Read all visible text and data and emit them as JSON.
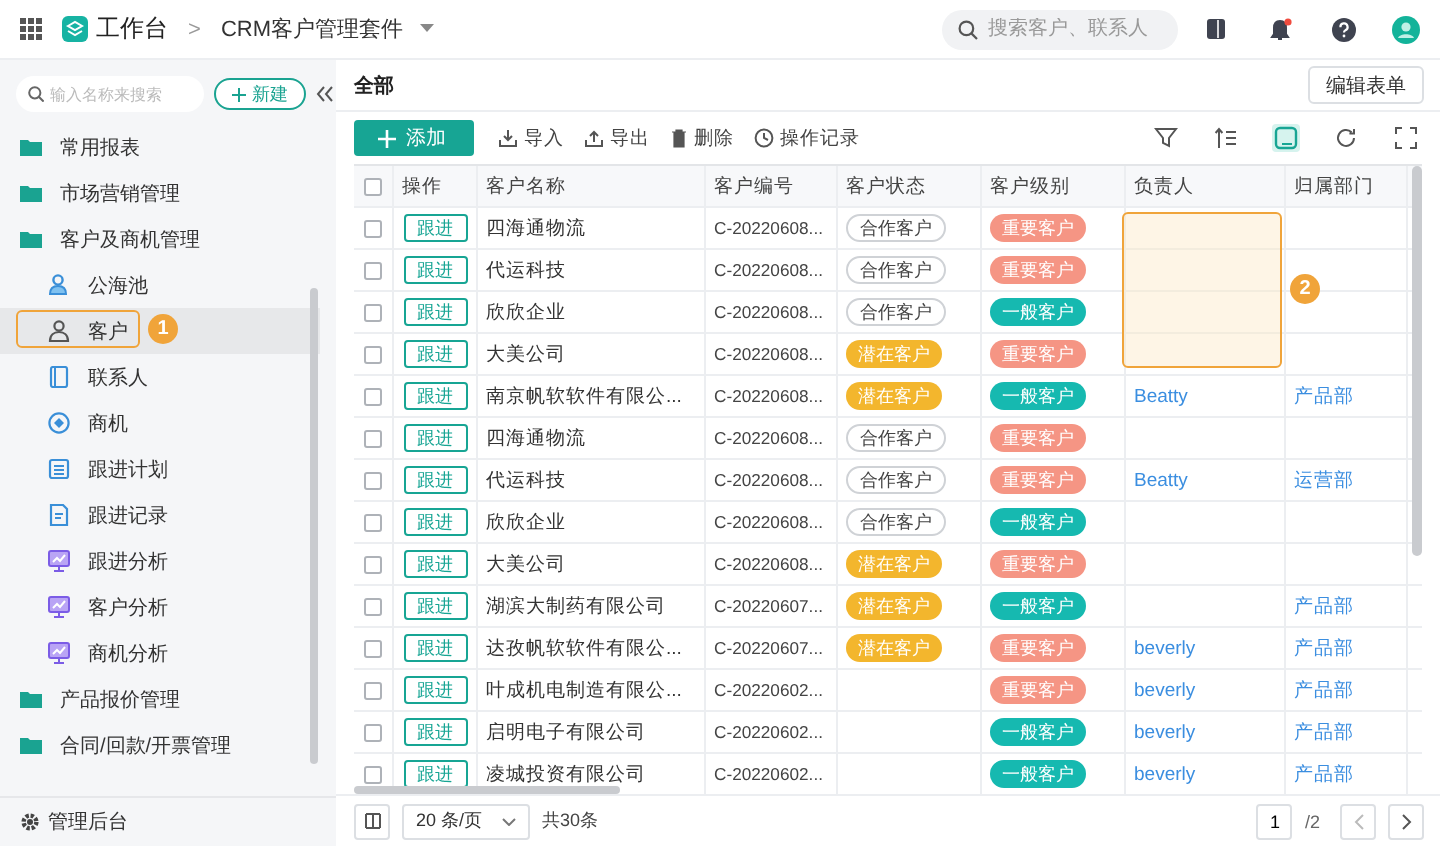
{
  "topbar": {
    "home": "工作台",
    "separator": ">",
    "app": "CRM客户管理套件",
    "search": {
      "placeholder": "搜索客户、联系人"
    },
    "notification_dot": true
  },
  "sidebar": {
    "search": {
      "placeholder": "输入名称来搜索"
    },
    "new_button": "新建",
    "items": [
      {
        "label": "常用报表",
        "selected": false
      },
      {
        "label": "市场营销管理",
        "selected": false
      },
      {
        "label": "客户及商机管理",
        "selected": false,
        "children": [
          {
            "label": "公海池",
            "kind": "pool",
            "selected": false
          },
          {
            "label": "客户",
            "kind": "customer",
            "selected": true,
            "callout": "1"
          },
          {
            "label": "联系人",
            "kind": "contact",
            "selected": false
          },
          {
            "label": "商机",
            "kind": "deal",
            "selected": false
          },
          {
            "label": "跟进计划",
            "kind": "plan",
            "selected": false
          },
          {
            "label": "跟进记录",
            "kind": "record",
            "selected": false
          },
          {
            "label": "跟进分析",
            "kind": "analysis",
            "selected": false
          },
          {
            "label": "客户分析",
            "kind": "analysis",
            "selected": false
          },
          {
            "label": "商机分析",
            "kind": "analysis",
            "selected": false
          }
        ]
      },
      {
        "label": "产品报价管理",
        "selected": false
      },
      {
        "label": "合同/回款/开票管理",
        "selected": false
      }
    ],
    "footer": "管理后台"
  },
  "main": {
    "title": "全部",
    "edit_button": "编辑表单",
    "toolbar": {
      "add": "添加",
      "actions": [
        {
          "label": "导入",
          "kind": "import"
        },
        {
          "label": "导出",
          "kind": "export"
        },
        {
          "label": "删除",
          "kind": "delete"
        },
        {
          "label": "操作记录",
          "kind": "history"
        }
      ],
      "card_view_active": true
    },
    "table": {
      "header_checked": false,
      "columns": [
        {
          "label": "操作"
        },
        {
          "label": "客户名称"
        },
        {
          "label": "客户编号"
        },
        {
          "label": "客户状态"
        },
        {
          "label": "客户级别"
        },
        {
          "label": "负责人",
          "callout": "2"
        },
        {
          "label": "归属部门"
        }
      ],
      "rows": [
        {
          "checked": false,
          "action": "跟进",
          "name": "四海通物流",
          "code": "C-20220608...",
          "status": {
            "text": "合作客户",
            "kind": "cooperating"
          },
          "level": {
            "text": "重要客户",
            "kind": "important"
          }
        },
        {
          "checked": false,
          "action": "跟进",
          "name": "代运科技",
          "code": "C-20220608...",
          "status": {
            "text": "合作客户",
            "kind": "cooperating"
          },
          "level": {
            "text": "重要客户",
            "kind": "important"
          }
        },
        {
          "checked": false,
          "action": "跟进",
          "name": "欣欣企业",
          "code": "C-20220608...",
          "status": {
            "text": "合作客户",
            "kind": "cooperating"
          },
          "level": {
            "text": "一般客户",
            "kind": "normal"
          }
        },
        {
          "checked": false,
          "action": "跟进",
          "name": "大美公司",
          "code": "C-20220608...",
          "status": {
            "text": "潜在客户",
            "kind": "potential"
          },
          "level": {
            "text": "重要客户",
            "kind": "important"
          }
        },
        {
          "checked": false,
          "action": "跟进",
          "name": "南京帆软软件有限公...",
          "code": "C-20220608...",
          "status": {
            "text": "潜在客户",
            "kind": "potential"
          },
          "level": {
            "text": "一般客户",
            "kind": "normal"
          },
          "owner": "Beatty",
          "dept": "产品部"
        },
        {
          "checked": false,
          "action": "跟进",
          "name": "四海通物流",
          "code": "C-20220608...",
          "status": {
            "text": "合作客户",
            "kind": "cooperating"
          },
          "level": {
            "text": "重要客户",
            "kind": "important"
          }
        },
        {
          "checked": false,
          "action": "跟进",
          "name": "代运科技",
          "code": "C-20220608...",
          "status": {
            "text": "合作客户",
            "kind": "cooperating"
          },
          "level": {
            "text": "重要客户",
            "kind": "important"
          },
          "owner": "Beatty",
          "dept": "运营部"
        },
        {
          "checked": false,
          "action": "跟进",
          "name": "欣欣企业",
          "code": "C-20220608...",
          "status": {
            "text": "合作客户",
            "kind": "cooperating"
          },
          "level": {
            "text": "一般客户",
            "kind": "normal"
          }
        },
        {
          "checked": false,
          "action": "跟进",
          "name": "大美公司",
          "code": "C-20220608...",
          "status": {
            "text": "潜在客户",
            "kind": "potential"
          },
          "level": {
            "text": "重要客户",
            "kind": "important"
          }
        },
        {
          "checked": false,
          "action": "跟进",
          "name": "湖滨大制药有限公司",
          "code": "C-20220607...",
          "status": {
            "text": "潜在客户",
            "kind": "potential"
          },
          "level": {
            "text": "一般客户",
            "kind": "normal"
          },
          "dept": "产品部"
        },
        {
          "checked": false,
          "action": "跟进",
          "name": "达孜帆软软件有限公...",
          "code": "C-20220607...",
          "status": {
            "text": "潜在客户",
            "kind": "potential"
          },
          "level": {
            "text": "重要客户",
            "kind": "important"
          },
          "owner": "beverly",
          "dept": "产品部"
        },
        {
          "checked": false,
          "action": "跟进",
          "name": "叶成机电制造有限公...",
          "code": "C-20220602...",
          "level": {
            "text": "重要客户",
            "kind": "important"
          },
          "owner": "beverly",
          "dept": "产品部"
        },
        {
          "checked": false,
          "action": "跟进",
          "name": "启明电子有限公司",
          "code": "C-20220602...",
          "level": {
            "text": "一般客户",
            "kind": "normal"
          },
          "owner": "beverly",
          "dept": "产品部"
        },
        {
          "checked": false,
          "action": "跟进",
          "name": "凌城投资有限公司",
          "code": "C-20220602...",
          "level": {
            "text": "一般客户",
            "kind": "normal"
          },
          "owner": "beverly",
          "dept": "产品部"
        }
      ]
    },
    "footer": {
      "page_size": "20 条/页",
      "total": "共30条",
      "page": "1",
      "pages": "/2"
    }
  }
}
